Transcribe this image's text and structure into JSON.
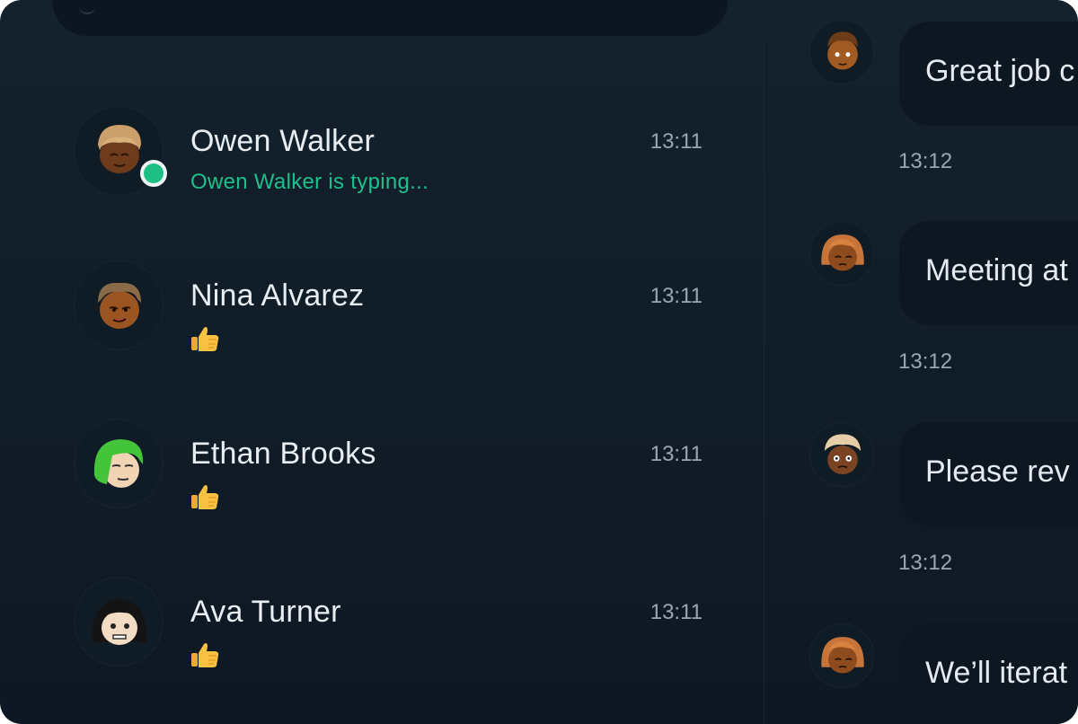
{
  "conversations": [
    {
      "name": "Owen Walker",
      "time": "13:11",
      "preview": "Owen Walker is typing...",
      "typing": true,
      "online": true,
      "avatar_icon": "blonde-person-avatar-icon"
    },
    {
      "name": "Nina Alvarez",
      "time": "13:11",
      "preview_icon": "thumbs-up-emoji",
      "typing": false,
      "avatar_icon": "brown-hair-person-avatar-icon"
    },
    {
      "name": "Ethan Brooks",
      "time": "13:11",
      "preview_icon": "thumbs-up-emoji",
      "typing": false,
      "avatar_icon": "green-hair-person-avatar-icon"
    },
    {
      "name": "Ava Turner",
      "time": "13:11",
      "preview_icon": "thumbs-up-emoji",
      "typing": false,
      "avatar_icon": "black-hair-person-avatar-icon"
    }
  ],
  "messages": [
    {
      "text": "Great job c",
      "time": "13:12"
    },
    {
      "text": "Meeting at",
      "time": "13:12"
    },
    {
      "text": "Please rev",
      "time": "13:12"
    },
    {
      "text": "We’ll iterat",
      "time": ""
    }
  ],
  "colors": {
    "background": "#101c27",
    "accent_online": "#1dbf84",
    "typing_text": "#1ec08a",
    "bubble": "#0c1722"
  }
}
